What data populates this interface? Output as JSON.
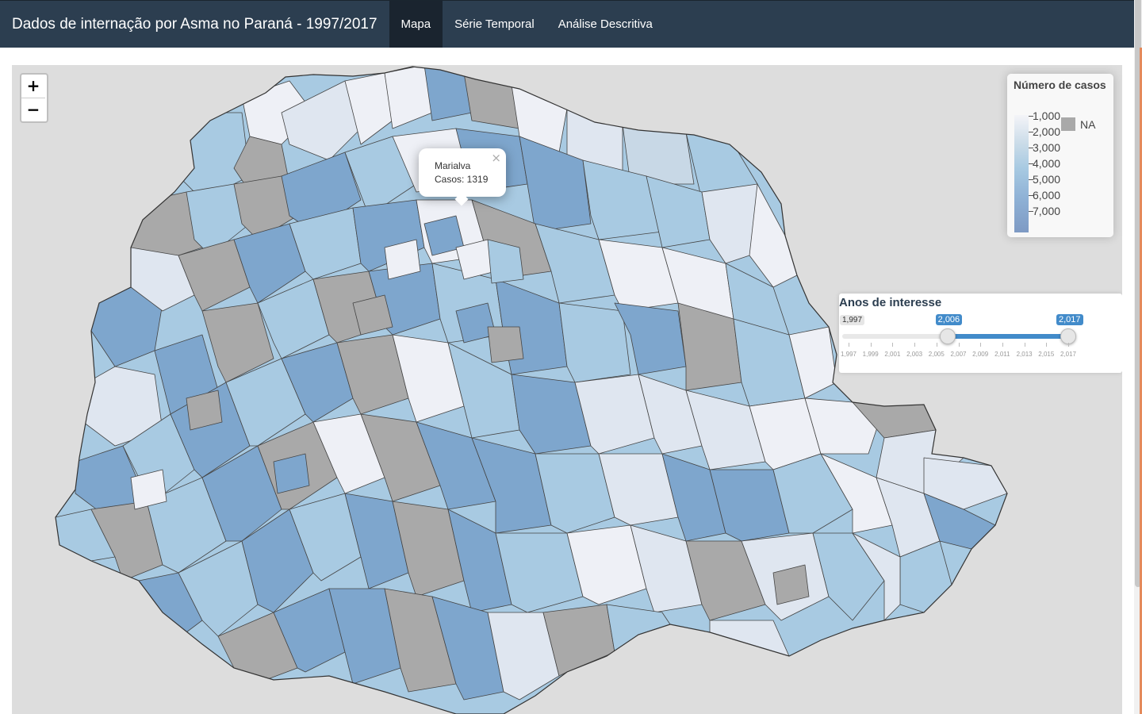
{
  "navbar": {
    "title": "Dados de internação por Asma no Paraná - 1997/2017",
    "tabs": [
      {
        "label": "Mapa",
        "active": true
      },
      {
        "label": "Série Temporal",
        "active": false
      },
      {
        "label": "Análise Descritiva",
        "active": false
      }
    ]
  },
  "map": {
    "zoom_in": "+",
    "zoom_out": "−",
    "popup": {
      "close": "×",
      "municipality": "Marialva",
      "cases_text": "Casos: 1319"
    },
    "legend": {
      "title": "Número de casos",
      "labels": [
        "1,000",
        "2,000",
        "3,000",
        "4,000",
        "5,000",
        "6,000",
        "7,000"
      ],
      "na_label": "NA",
      "colors": {
        "low": "#f4f4f8",
        "mid": "#a8cae2",
        "high": "#7e9ac4",
        "na": "#a9a9a9"
      }
    }
  },
  "slider": {
    "title": "Anos de interesse",
    "min": 1997,
    "max": 2017,
    "min_label": "1,997",
    "from": 2006,
    "to": 2017,
    "from_label": "2,006",
    "to_label": "2,017",
    "ticks": [
      "1,997",
      "1,999",
      "2,001",
      "2,003",
      "2,005",
      "2,007",
      "2,009",
      "2,011",
      "2,013",
      "2,015",
      "2,017"
    ],
    "accent_color": "#428bca"
  },
  "colors": {
    "navbar_bg": "#2c3e50",
    "navbar_active": "#1a242f",
    "map_bg": "#dddddd"
  }
}
